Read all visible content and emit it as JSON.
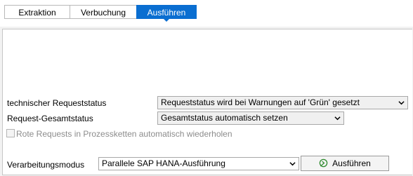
{
  "tabs": [
    {
      "label": "Extraktion",
      "active": false
    },
    {
      "label": "Verbuchung",
      "active": false
    },
    {
      "label": "Ausführen",
      "active": true
    }
  ],
  "form": {
    "tech_status": {
      "label": "technischer Requeststatus",
      "value": "Requeststatus wird bei Warnungen auf 'Grün' gesetzt"
    },
    "overall_status": {
      "label": "Request-Gesamtstatus",
      "value": "Gesamtstatus automatisch setzen"
    },
    "retry_checkbox": {
      "label": "Rote Requests in Prozessketten automatisch wiederholen",
      "checked": false,
      "enabled": false
    },
    "processing_mode": {
      "label": "Verarbeitungsmodus",
      "value": "Parallele SAP HANA-Ausführung"
    },
    "execute_button": {
      "label": "Ausführen",
      "icon": "execute-icon"
    }
  },
  "colors": {
    "accent": "#0a6ed1",
    "execute_icon": "#2e8a2e"
  }
}
